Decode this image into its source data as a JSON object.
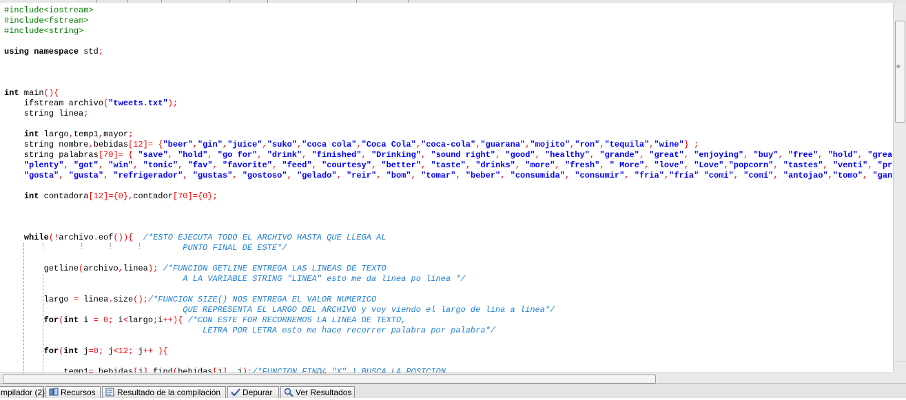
{
  "code_lines": [
    [
      {
        "t": "#include<iostream>",
        "c": "pp"
      }
    ],
    [
      {
        "t": "#include<fstream>",
        "c": "pp"
      }
    ],
    [
      {
        "t": "#include<string>",
        "c": "pp"
      }
    ],
    [],
    [
      {
        "t": "using namespace",
        "c": "kw"
      },
      {
        "t": " std"
      },
      {
        "t": ";",
        "c": "op"
      }
    ],
    [],
    [],
    [],
    [
      {
        "t": "int",
        "c": "kw"
      },
      {
        "t": " main"
      },
      {
        "t": "(){",
        "c": "op"
      }
    ],
    [
      {
        "t": "    ifstream archivo"
      },
      {
        "t": "(",
        "c": "op"
      },
      {
        "t": "\"tweets.txt\"",
        "c": "str"
      },
      {
        "t": ");",
        "c": "op"
      }
    ],
    [
      {
        "t": "    string linea"
      },
      {
        "t": ";",
        "c": "op"
      }
    ],
    [],
    [
      {
        "t": "    "
      },
      {
        "t": "int",
        "c": "kw"
      },
      {
        "t": " largo"
      },
      {
        "t": ",",
        "c": "op"
      },
      {
        "t": "temp1"
      },
      {
        "t": ",",
        "c": "op"
      },
      {
        "t": "mayor"
      },
      {
        "t": ";",
        "c": "op"
      }
    ],
    [
      {
        "t": "    string nombre"
      },
      {
        "t": ",",
        "c": "op"
      },
      {
        "t": "bebidas"
      },
      {
        "t": "[",
        "c": "op"
      },
      {
        "t": "12",
        "c": "num"
      },
      {
        "t": "]= {",
        "c": "op"
      },
      {
        "t": "\"beer\"",
        "c": "str"
      },
      {
        "t": ",",
        "c": "op"
      },
      {
        "t": "\"gin\"",
        "c": "str"
      },
      {
        "t": ",",
        "c": "op"
      },
      {
        "t": "\"juice\"",
        "c": "str"
      },
      {
        "t": ",",
        "c": "op"
      },
      {
        "t": "\"suko\"",
        "c": "str"
      },
      {
        "t": ",",
        "c": "op"
      },
      {
        "t": "\"coca cola\"",
        "c": "str"
      },
      {
        "t": ",",
        "c": "op"
      },
      {
        "t": "\"Coca Cola\"",
        "c": "str"
      },
      {
        "t": ",",
        "c": "op"
      },
      {
        "t": "\"coca-cola\"",
        "c": "str"
      },
      {
        "t": ",",
        "c": "op"
      },
      {
        "t": "\"guarana\"",
        "c": "str"
      },
      {
        "t": ",",
        "c": "op"
      },
      {
        "t": "\"mojito\"",
        "c": "str"
      },
      {
        "t": ",",
        "c": "op"
      },
      {
        "t": "\"ron\"",
        "c": "str"
      },
      {
        "t": ",",
        "c": "op"
      },
      {
        "t": "\"tequila\"",
        "c": "str"
      },
      {
        "t": ",",
        "c": "op"
      },
      {
        "t": "\"wine\"",
        "c": "str"
      },
      {
        "t": "} ;",
        "c": "op"
      }
    ],
    [
      {
        "t": "    string palabras"
      },
      {
        "t": "[",
        "c": "op"
      },
      {
        "t": "70",
        "c": "num"
      },
      {
        "t": "]= { ",
        "c": "op"
      },
      {
        "t": "\"save\"",
        "c": "str"
      },
      {
        "t": ", ",
        "c": "op"
      },
      {
        "t": "\"hold\"",
        "c": "str"
      },
      {
        "t": ", ",
        "c": "op"
      },
      {
        "t": "\"go for\"",
        "c": "str"
      },
      {
        "t": ", ",
        "c": "op"
      },
      {
        "t": "\"drink\"",
        "c": "str"
      },
      {
        "t": ", ",
        "c": "op"
      },
      {
        "t": "\"finished\"",
        "c": "str"
      },
      {
        "t": ", ",
        "c": "op"
      },
      {
        "t": "\"Drinking\"",
        "c": "str"
      },
      {
        "t": ", ",
        "c": "op"
      },
      {
        "t": "\"sound right\"",
        "c": "str"
      },
      {
        "t": ", ",
        "c": "op"
      },
      {
        "t": "\"good\"",
        "c": "str"
      },
      {
        "t": ", ",
        "c": "op"
      },
      {
        "t": "\"healthy\"",
        "c": "str"
      },
      {
        "t": ", ",
        "c": "op"
      },
      {
        "t": "\"grande\"",
        "c": "str"
      },
      {
        "t": ", ",
        "c": "op"
      },
      {
        "t": "\"great\"",
        "c": "str"
      },
      {
        "t": ", ",
        "c": "op"
      },
      {
        "t": "\"enjoying\"",
        "c": "str"
      },
      {
        "t": ", ",
        "c": "op"
      },
      {
        "t": "\"buy\"",
        "c": "str"
      },
      {
        "t": ", ",
        "c": "op"
      },
      {
        "t": "\"free\"",
        "c": "str"
      },
      {
        "t": ", ",
        "c": "op"
      },
      {
        "t": "\"hold\"",
        "c": "str"
      },
      {
        "t": ", ",
        "c": "op"
      },
      {
        "t": "\"greatest\"",
        "c": "str"
      }
    ],
    [
      {
        "t": "    "
      },
      {
        "t": "\"plenty\"",
        "c": "str"
      },
      {
        "t": ", ",
        "c": "op"
      },
      {
        "t": "\"got\"",
        "c": "str"
      },
      {
        "t": ", ",
        "c": "op"
      },
      {
        "t": "\"win\"",
        "c": "str"
      },
      {
        "t": ", ",
        "c": "op"
      },
      {
        "t": "\"tonic\"",
        "c": "str"
      },
      {
        "t": ", ",
        "c": "op"
      },
      {
        "t": "\"fav\"",
        "c": "str"
      },
      {
        "t": ", ",
        "c": "op"
      },
      {
        "t": "\"favorite\"",
        "c": "str"
      },
      {
        "t": ", ",
        "c": "op"
      },
      {
        "t": "\"feed\"",
        "c": "str"
      },
      {
        "t": ", ",
        "c": "op"
      },
      {
        "t": "\"courtesy\"",
        "c": "str"
      },
      {
        "t": ", ",
        "c": "op"
      },
      {
        "t": "\"better\"",
        "c": "str"
      },
      {
        "t": ", ",
        "c": "op"
      },
      {
        "t": "\"taste\"",
        "c": "str"
      },
      {
        "t": ", ",
        "c": "op"
      },
      {
        "t": "\"drinks\"",
        "c": "str"
      },
      {
        "t": ", ",
        "c": "op"
      },
      {
        "t": "\"more\"",
        "c": "str"
      },
      {
        "t": ", ",
        "c": "op"
      },
      {
        "t": "\"fresh\"",
        "c": "str"
      },
      {
        "t": ", ",
        "c": "op"
      },
      {
        "t": "\" More\"",
        "c": "str"
      },
      {
        "t": ", ",
        "c": "op"
      },
      {
        "t": "\"love\"",
        "c": "str"
      },
      {
        "t": ", ",
        "c": "op"
      },
      {
        "t": "\"Love\"",
        "c": "str"
      },
      {
        "t": ",",
        "c": "op"
      },
      {
        "t": "\"popcorn\"",
        "c": "str"
      },
      {
        "t": ", ",
        "c": "op"
      },
      {
        "t": "\"tastes\"",
        "c": "str"
      },
      {
        "t": ", ",
        "c": "op"
      },
      {
        "t": "\"venti\"",
        "c": "str"
      },
      {
        "t": ", ",
        "c": "op"
      },
      {
        "t": "\"prefier",
        "c": "str"
      }
    ],
    [
      {
        "t": "    "
      },
      {
        "t": "\"gosta\"",
        "c": "str"
      },
      {
        "t": ", ",
        "c": "op"
      },
      {
        "t": "\"gusta\"",
        "c": "str"
      },
      {
        "t": ", ",
        "c": "op"
      },
      {
        "t": "\"refrigerador\"",
        "c": "str"
      },
      {
        "t": ", ",
        "c": "op"
      },
      {
        "t": "\"gustas\"",
        "c": "str"
      },
      {
        "t": ", ",
        "c": "op"
      },
      {
        "t": "\"gostoso\"",
        "c": "str"
      },
      {
        "t": ", ",
        "c": "op"
      },
      {
        "t": "\"gelado\"",
        "c": "str"
      },
      {
        "t": ", ",
        "c": "op"
      },
      {
        "t": "\"reir\"",
        "c": "str"
      },
      {
        "t": ", ",
        "c": "op"
      },
      {
        "t": "\"bom\"",
        "c": "str"
      },
      {
        "t": ", ",
        "c": "op"
      },
      {
        "t": "\"tomar\"",
        "c": "str"
      },
      {
        "t": ", ",
        "c": "op"
      },
      {
        "t": "\"beber\"",
        "c": "str"
      },
      {
        "t": ", ",
        "c": "op"
      },
      {
        "t": "\"consumida\"",
        "c": "str"
      },
      {
        "t": ", ",
        "c": "op"
      },
      {
        "t": "\"consumir\"",
        "c": "str"
      },
      {
        "t": ", ",
        "c": "op"
      },
      {
        "t": "\"fria\"",
        "c": "str"
      },
      {
        "t": ",",
        "c": "op"
      },
      {
        "t": "\"fría\"",
        "c": "str"
      },
      {
        "t": " "
      },
      {
        "t": "\"comi\"",
        "c": "str"
      },
      {
        "t": ", ",
        "c": "op"
      },
      {
        "t": "\"comí\"",
        "c": "str"
      },
      {
        "t": ", ",
        "c": "op"
      },
      {
        "t": "\"antojao\"",
        "c": "str"
      },
      {
        "t": ",",
        "c": "op"
      },
      {
        "t": "\"tomo\"",
        "c": "str"
      },
      {
        "t": ", ",
        "c": "op"
      },
      {
        "t": "\"ganas\"",
        "c": "str"
      },
      {
        "t": ",",
        "c": "op"
      }
    ],
    [],
    [
      {
        "t": "    "
      },
      {
        "t": "int",
        "c": "kw"
      },
      {
        "t": " contadora"
      },
      {
        "t": "[",
        "c": "op"
      },
      {
        "t": "12",
        "c": "num"
      },
      {
        "t": "]={",
        "c": "op"
      },
      {
        "t": "0",
        "c": "num"
      },
      {
        "t": "},",
        "c": "op"
      },
      {
        "t": "contador"
      },
      {
        "t": "[",
        "c": "op"
      },
      {
        "t": "70",
        "c": "num"
      },
      {
        "t": "]={",
        "c": "op"
      },
      {
        "t": "0",
        "c": "num"
      },
      {
        "t": "};",
        "c": "op"
      }
    ],
    [],
    [],
    [],
    [
      {
        "t": "    "
      },
      {
        "t": "while",
        "c": "kw"
      },
      {
        "t": "(!",
        "c": "op"
      },
      {
        "t": "archivo"
      },
      {
        "t": ".",
        "c": "op"
      },
      {
        "t": "eof"
      },
      {
        "t": "()){",
        "c": "op"
      },
      {
        "t": "  "
      },
      {
        "t": "/*ESTO EJECUTA TODO EL ARCHIVO HASTA QUE LLEGA AL",
        "c": "cmt"
      }
    ],
    [
      {
        "t": "                                    "
      },
      {
        "t": "PUNTO FINAL DE ESTE*/",
        "c": "cmt"
      }
    ],
    [],
    [
      {
        "t": "        getline"
      },
      {
        "t": "(",
        "c": "op"
      },
      {
        "t": "archivo"
      },
      {
        "t": ",",
        "c": "op"
      },
      {
        "t": "linea"
      },
      {
        "t": ");",
        "c": "op"
      },
      {
        "t": " "
      },
      {
        "t": "/*FUNCION GETLINE ENTREGA LAS LINEAS DE TEXTO",
        "c": "cmt"
      }
    ],
    [
      {
        "t": "                                    "
      },
      {
        "t": "A LA VARIABLE STRING \"LINEA\" esto me da linea po linea */",
        "c": "cmt"
      }
    ],
    [],
    [
      {
        "t": "        largo "
      },
      {
        "t": "=",
        "c": "op"
      },
      {
        "t": " linea"
      },
      {
        "t": ".",
        "c": "op"
      },
      {
        "t": "size"
      },
      {
        "t": "();",
        "c": "op"
      },
      {
        "t": "/*FUNCION SIZE() NOS ENTREGA EL VALOR NUMERICO",
        "c": "cmt"
      }
    ],
    [
      {
        "t": "                                    "
      },
      {
        "t": "QUE REPRESENTA EL LARGO DEL ARCHIVO y voy viendo el largo de lina a linea*/",
        "c": "cmt"
      }
    ],
    [
      {
        "t": "        "
      },
      {
        "t": "for",
        "c": "kw"
      },
      {
        "t": "(",
        "c": "op"
      },
      {
        "t": "int",
        "c": "kw"
      },
      {
        "t": " i "
      },
      {
        "t": "=",
        "c": "op"
      },
      {
        "t": " "
      },
      {
        "t": "0",
        "c": "num"
      },
      {
        "t": ";",
        "c": "op"
      },
      {
        "t": " i"
      },
      {
        "t": "<",
        "c": "op"
      },
      {
        "t": "largo"
      },
      {
        "t": ";",
        "c": "op"
      },
      {
        "t": "i"
      },
      {
        "t": "++){",
        "c": "op"
      },
      {
        "t": " "
      },
      {
        "t": "/*CON ESTE FOR RECORREMOS LA LINEA DE TEXTO,",
        "c": "cmt"
      }
    ],
    [
      {
        "t": "                                        "
      },
      {
        "t": "LETRA POR LETRA esto me hace recorrer palabra por palabra*/",
        "c": "cmt"
      }
    ],
    [],
    [
      {
        "t": "        "
      },
      {
        "t": "for",
        "c": "kw"
      },
      {
        "t": "(",
        "c": "op"
      },
      {
        "t": "int",
        "c": "kw"
      },
      {
        "t": " j"
      },
      {
        "t": "=",
        "c": "op"
      },
      {
        "t": "0",
        "c": "num"
      },
      {
        "t": ";",
        "c": "op"
      },
      {
        "t": " j"
      },
      {
        "t": "<",
        "c": "op"
      },
      {
        "t": "12",
        "c": "num"
      },
      {
        "t": ";",
        "c": "op"
      },
      {
        "t": " j"
      },
      {
        "t": "++",
        "c": "op"
      },
      {
        "t": " "
      },
      {
        "t": "){",
        "c": "op"
      }
    ],
    [],
    [
      {
        "t": "            temp1"
      },
      {
        "t": "=",
        "c": "op"
      },
      {
        "t": " bebidas"
      },
      {
        "t": "[",
        "c": "op"
      },
      {
        "t": "j"
      },
      {
        "t": "].",
        "c": "op"
      },
      {
        "t": "find"
      },
      {
        "t": "(",
        "c": "op"
      },
      {
        "t": "bebidas"
      },
      {
        "t": "[",
        "c": "op"
      },
      {
        "t": "j"
      },
      {
        "t": "],",
        "c": "op"
      },
      {
        "t": " j"
      },
      {
        "t": ");",
        "c": "op"
      },
      {
        "t": "/*FUNCION FIND( \"X\" ) BUSCA LA POSICION",
        "c": "cmt"
      }
    ]
  ],
  "hscroll_grip": "'''",
  "bottom_tabs": {
    "compiler": "mpilador (2)",
    "resources": "Recursos",
    "compile_log": "Resultado de la compilación",
    "debug": "Depurar",
    "results": "Ver Resultados"
  }
}
